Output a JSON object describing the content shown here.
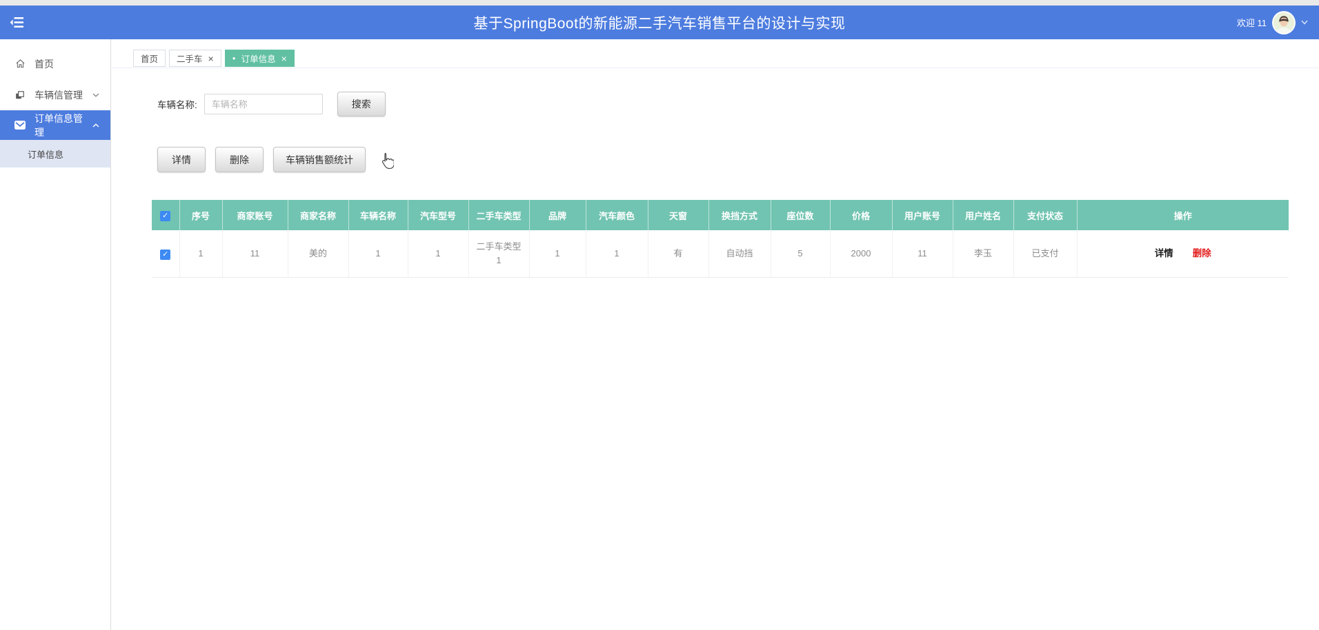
{
  "header": {
    "title": "基于SpringBoot的新能源二手汽车销售平台的设计与实现",
    "welcome": "欢迎 11"
  },
  "sidebar": {
    "items": [
      {
        "label": "首页",
        "icon": "home-icon"
      },
      {
        "label": "车辆信管理",
        "icon": "copy-icon",
        "chevron": "down"
      },
      {
        "label": "订单信息管理",
        "icon": "mail-icon",
        "chevron": "up",
        "active": true
      }
    ],
    "submenu": [
      {
        "label": "订单信息"
      }
    ]
  },
  "tabs": [
    {
      "label": "首页",
      "closable": false,
      "active": false
    },
    {
      "label": "二手车",
      "closable": true,
      "active": false
    },
    {
      "label": "订单信息",
      "closable": true,
      "active": true
    }
  ],
  "icons": {
    "close": "×",
    "check": "✓",
    "active_dot": "●"
  },
  "search": {
    "label": "车辆名称:",
    "placeholder": "车辆名称",
    "button_label": "搜索"
  },
  "toolbar": {
    "detail_label": "详情",
    "delete_label": "删除",
    "stats_label": "车辆销售额统计"
  },
  "table": {
    "headers": [
      "序号",
      "商家账号",
      "商家名称",
      "车辆名称",
      "汽车型号",
      "二手车类型",
      "品牌",
      "汽车颜色",
      "天窗",
      "换挡方式",
      "座位数",
      "价格",
      "用户账号",
      "用户姓名",
      "支付状态",
      "操作"
    ],
    "rows": [
      {
        "checked": true,
        "cells": [
          "1",
          "11",
          "美的",
          "1",
          "1",
          "二手车类型1",
          "1",
          "1",
          "有",
          "自动挡",
          "5",
          "2000",
          "11",
          "李玉",
          "已支付"
        ],
        "action_detail": "详情",
        "action_delete": "删除"
      }
    ]
  },
  "colors": {
    "header_blue": "#4d7cdf",
    "active_tab_green": "#62c0a2",
    "table_header_teal": "#71c4b1",
    "delete_red": "#e31d1d",
    "checkbox_blue": "#3d8af2",
    "submenu_bg": "#dfe5f3"
  }
}
